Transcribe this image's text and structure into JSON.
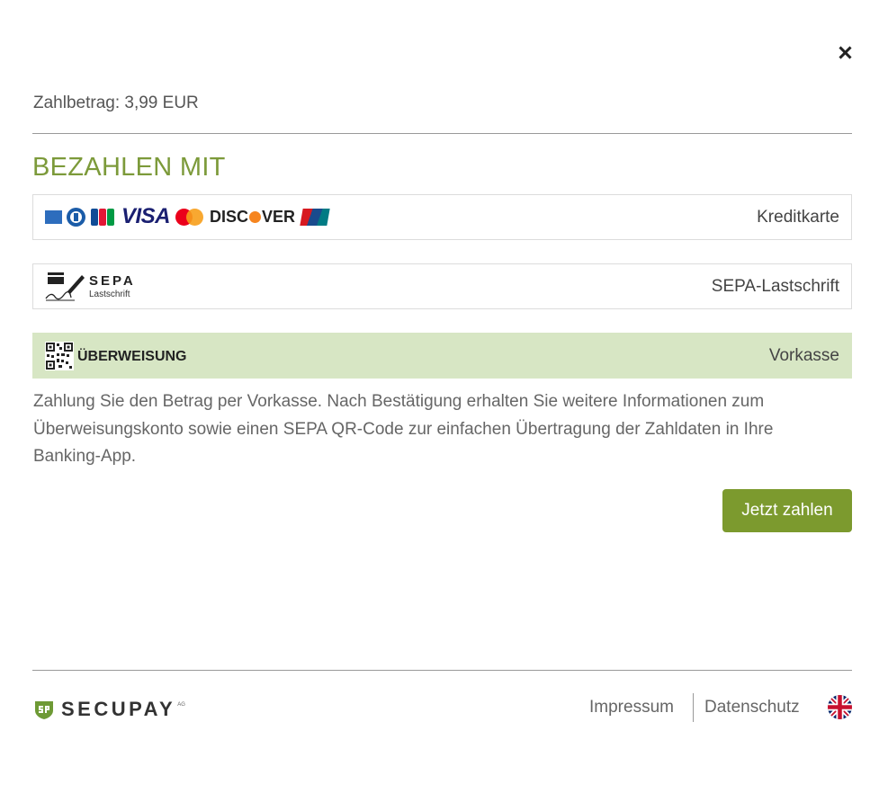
{
  "payment": {
    "amount_label": "Zahlbetrag: 3,99 EUR",
    "heading": "BEZAHLEN MIT"
  },
  "methods": [
    {
      "label": "Kreditkarte",
      "brands": [
        "american-express",
        "diners-club",
        "jcb",
        "visa",
        "mastercard",
        "discover",
        "unionpay"
      ],
      "active": false
    },
    {
      "label": "SEPA-Lastschrift",
      "logo_text": "SEPA",
      "logo_subtext": "Lastschrift",
      "active": false
    },
    {
      "label": "Vorkasse",
      "logo_text": "ÜBERWEISUNG",
      "active": true
    }
  ],
  "brand_text": {
    "visa": "VISA",
    "discover_left": "DISC",
    "discover_right": "VER"
  },
  "description": "Zahlung Sie den Betrag per Vorkasse. Nach Bestätigung erhalten Sie weitere Informationen zum Überweisungskonto sowie einen SEPA QR-Code zur einfachen Übertragung der Zahldaten in Ihre Banking-App.",
  "pay_button": "Jetzt zahlen",
  "footer": {
    "logo_text": "SECUPAY",
    "logo_suffix": "AG",
    "links": [
      "Impressum",
      "Datenschutz"
    ],
    "language_icon": "uk-flag-icon"
  },
  "colors": {
    "accent_green": "#7c9a2e",
    "heading_green": "#7c9a3a",
    "active_method_bg": "#d7e6c4"
  }
}
